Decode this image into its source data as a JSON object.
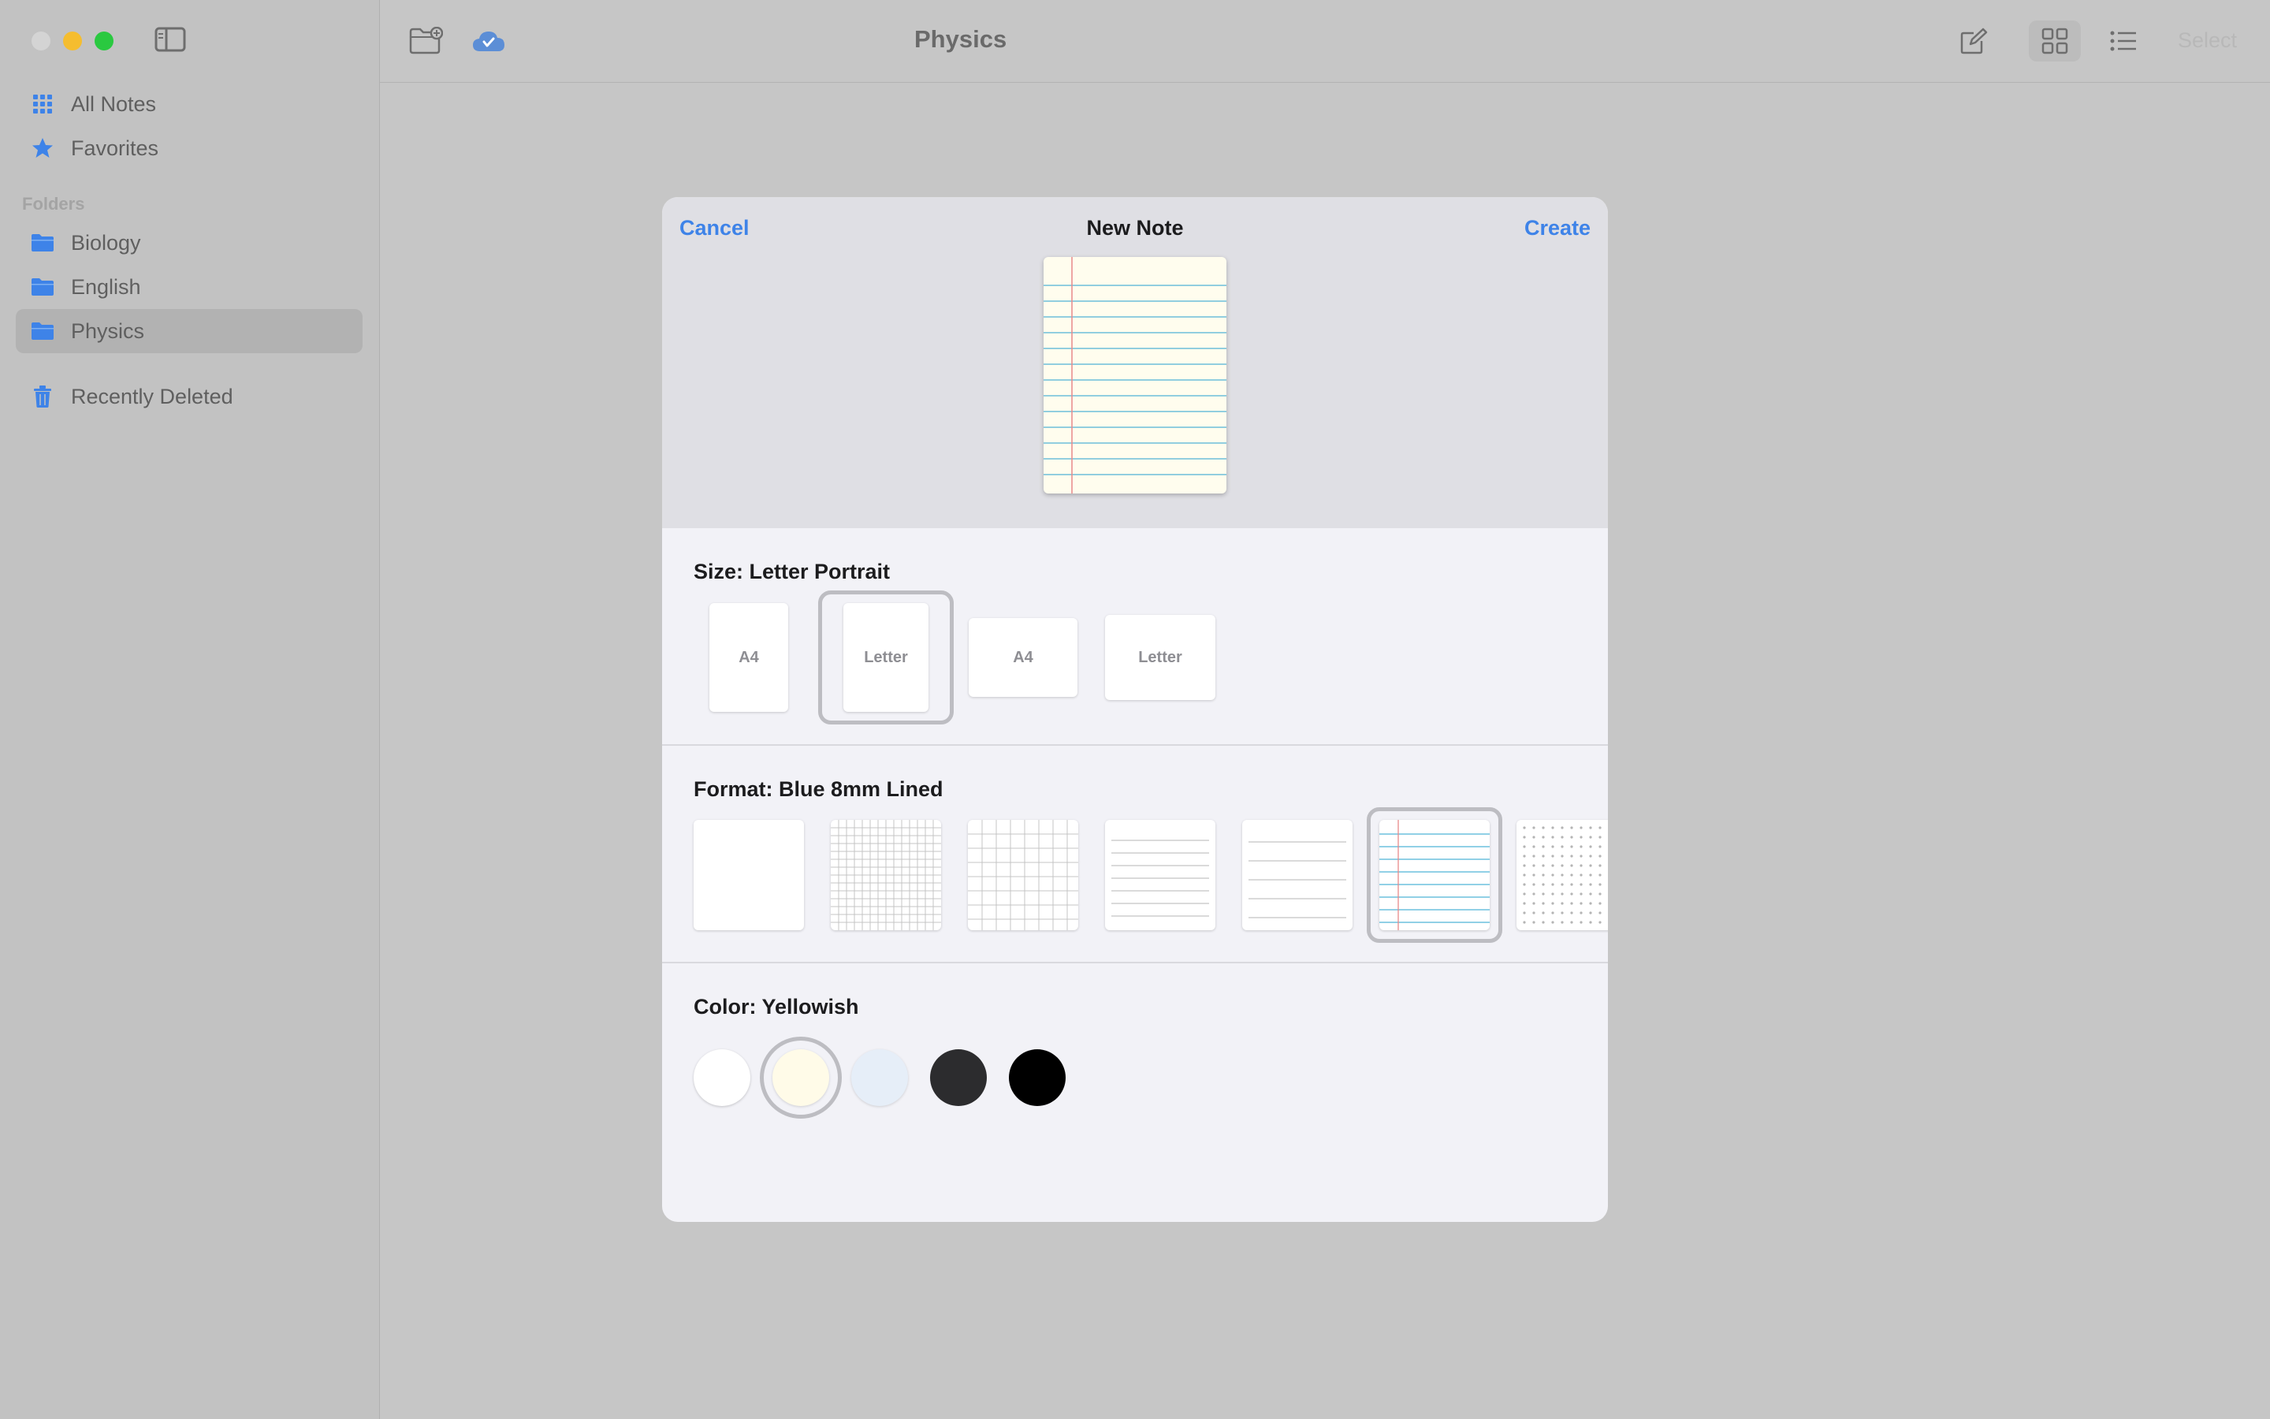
{
  "window": {
    "traffic_lights": {
      "close": "#d4d4d4",
      "minimize": "#f5bd2f",
      "zoom": "#2ac940"
    }
  },
  "sidebar": {
    "items": [
      {
        "label": "All Notes",
        "icon": "grid-dots-icon"
      },
      {
        "label": "Favorites",
        "icon": "star-icon"
      }
    ],
    "folders_header": "Folders",
    "folders": [
      {
        "label": "Biology",
        "icon": "folder-icon"
      },
      {
        "label": "English",
        "icon": "folder-icon"
      },
      {
        "label": "Physics",
        "icon": "folder-icon",
        "selected": true
      }
    ],
    "recently_deleted": {
      "label": "Recently Deleted",
      "icon": "trash-icon"
    },
    "accent_color": "#3e83e8"
  },
  "toolbar": {
    "title": "Physics",
    "select_label": "Select",
    "icons": [
      "new-folder-icon",
      "icloud-check-icon",
      "compose-icon",
      "grid-view-icon",
      "list-view-icon"
    ]
  },
  "dialog": {
    "cancel_label": "Cancel",
    "title": "New Note",
    "create_label": "Create",
    "size_label": "Size: Letter Portrait",
    "sizes": [
      {
        "label": "A4",
        "orientation": "portrait"
      },
      {
        "label": "Letter",
        "orientation": "portrait",
        "selected": true
      },
      {
        "label": "A4",
        "orientation": "landscape"
      },
      {
        "label": "Letter",
        "orientation": "landscape"
      }
    ],
    "format_label": "Format: Blue 8mm Lined",
    "formats": [
      "blank",
      "small-grid",
      "large-grid",
      "narrow-lined",
      "wide-lined",
      "blue-lined-selected",
      "dotted"
    ],
    "color_label": "Color: Yellowish",
    "colors": [
      {
        "name": "white",
        "hex": "#ffffff"
      },
      {
        "name": "yellowish",
        "hex": "#fffbe8",
        "selected": true
      },
      {
        "name": "bluish",
        "hex": "#e6eef8"
      },
      {
        "name": "dark-gray",
        "hex": "#2c2c2e"
      },
      {
        "name": "black",
        "hex": "#000000"
      }
    ]
  }
}
